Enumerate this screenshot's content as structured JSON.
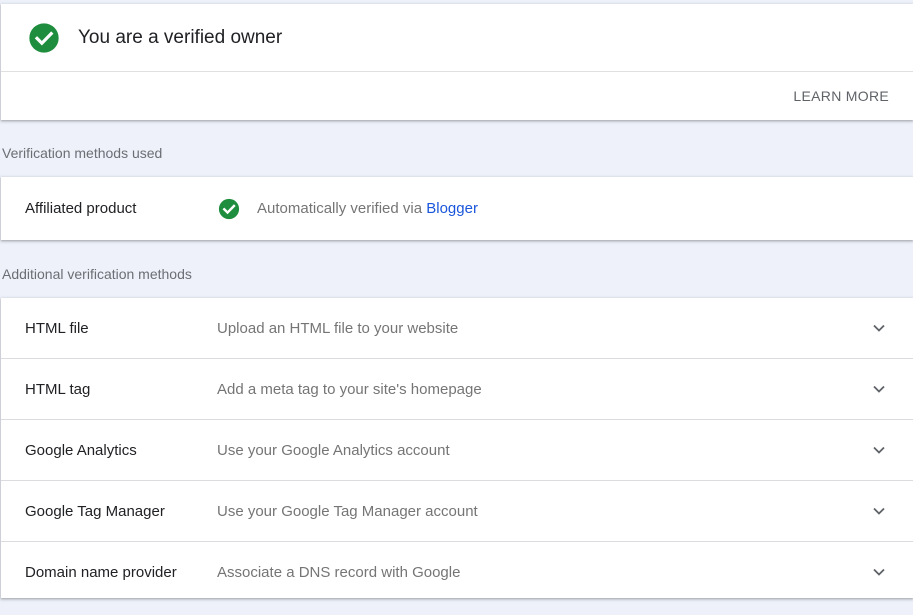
{
  "owner": {
    "title": "You are a verified owner",
    "learn_more": "LEARN MORE",
    "icon": "check-circle-icon"
  },
  "used_section": {
    "heading": "Verification methods used",
    "items": [
      {
        "label": "Affiliated product",
        "status_icon": "check-circle-icon",
        "description_prefix": "Automatically verified via",
        "link_text": "Blogger"
      }
    ]
  },
  "additional_section": {
    "heading": "Additional verification methods",
    "items": [
      {
        "label": "HTML file",
        "description": "Upload an HTML file to your website"
      },
      {
        "label": "HTML tag",
        "description": "Add a meta tag to your site's homepage"
      },
      {
        "label": "Google Analytics",
        "description": "Use your Google Analytics account"
      },
      {
        "label": "Google Tag Manager",
        "description": "Use your Google Tag Manager account"
      },
      {
        "label": "Domain name provider",
        "description": "Associate a DNS record with Google"
      }
    ]
  },
  "colors": {
    "success_green": "#1e8e3e",
    "link_blue": "#1a56db",
    "page_background": "#eef1f9"
  }
}
